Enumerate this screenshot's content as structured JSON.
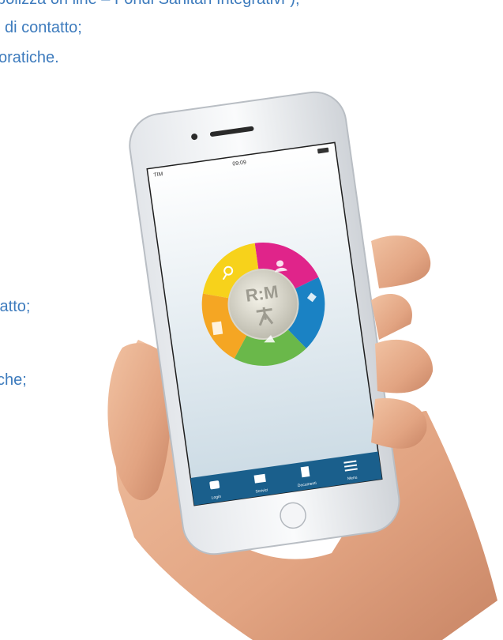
{
  "page": {
    "background_text": [
      "polizza on line – Fondi Sanitari Integrativi”);",
      "di contatto;",
      "oratiche.",
      "tatto;",
      "che;"
    ]
  },
  "phone": {
    "status_bar": {
      "carrier": "TIM",
      "time": "09:09",
      "battery": "100%"
    },
    "app": {
      "logo_text": "R:M",
      "wheel_segments": [
        {
          "name": "pink",
          "color": "#e0248a"
        },
        {
          "name": "blue",
          "color": "#1a82c4"
        },
        {
          "name": "green",
          "color": "#6ab84a"
        },
        {
          "name": "orange",
          "color": "#f5a623"
        },
        {
          "name": "yellow",
          "color": "#f7d21b"
        }
      ]
    },
    "tab_bar": {
      "items": [
        {
          "label": "Login",
          "icon": "lock-icon"
        },
        {
          "label": "Scrivici",
          "icon": "mail-icon"
        },
        {
          "label": "Documenti",
          "icon": "document-icon"
        },
        {
          "label": "Menu",
          "icon": "menu-icon"
        }
      ]
    }
  },
  "colors": {
    "text_blue": "#3d7bbd",
    "tab_bar": "#1a5f8c",
    "accent_green": "#1f9a3c"
  }
}
